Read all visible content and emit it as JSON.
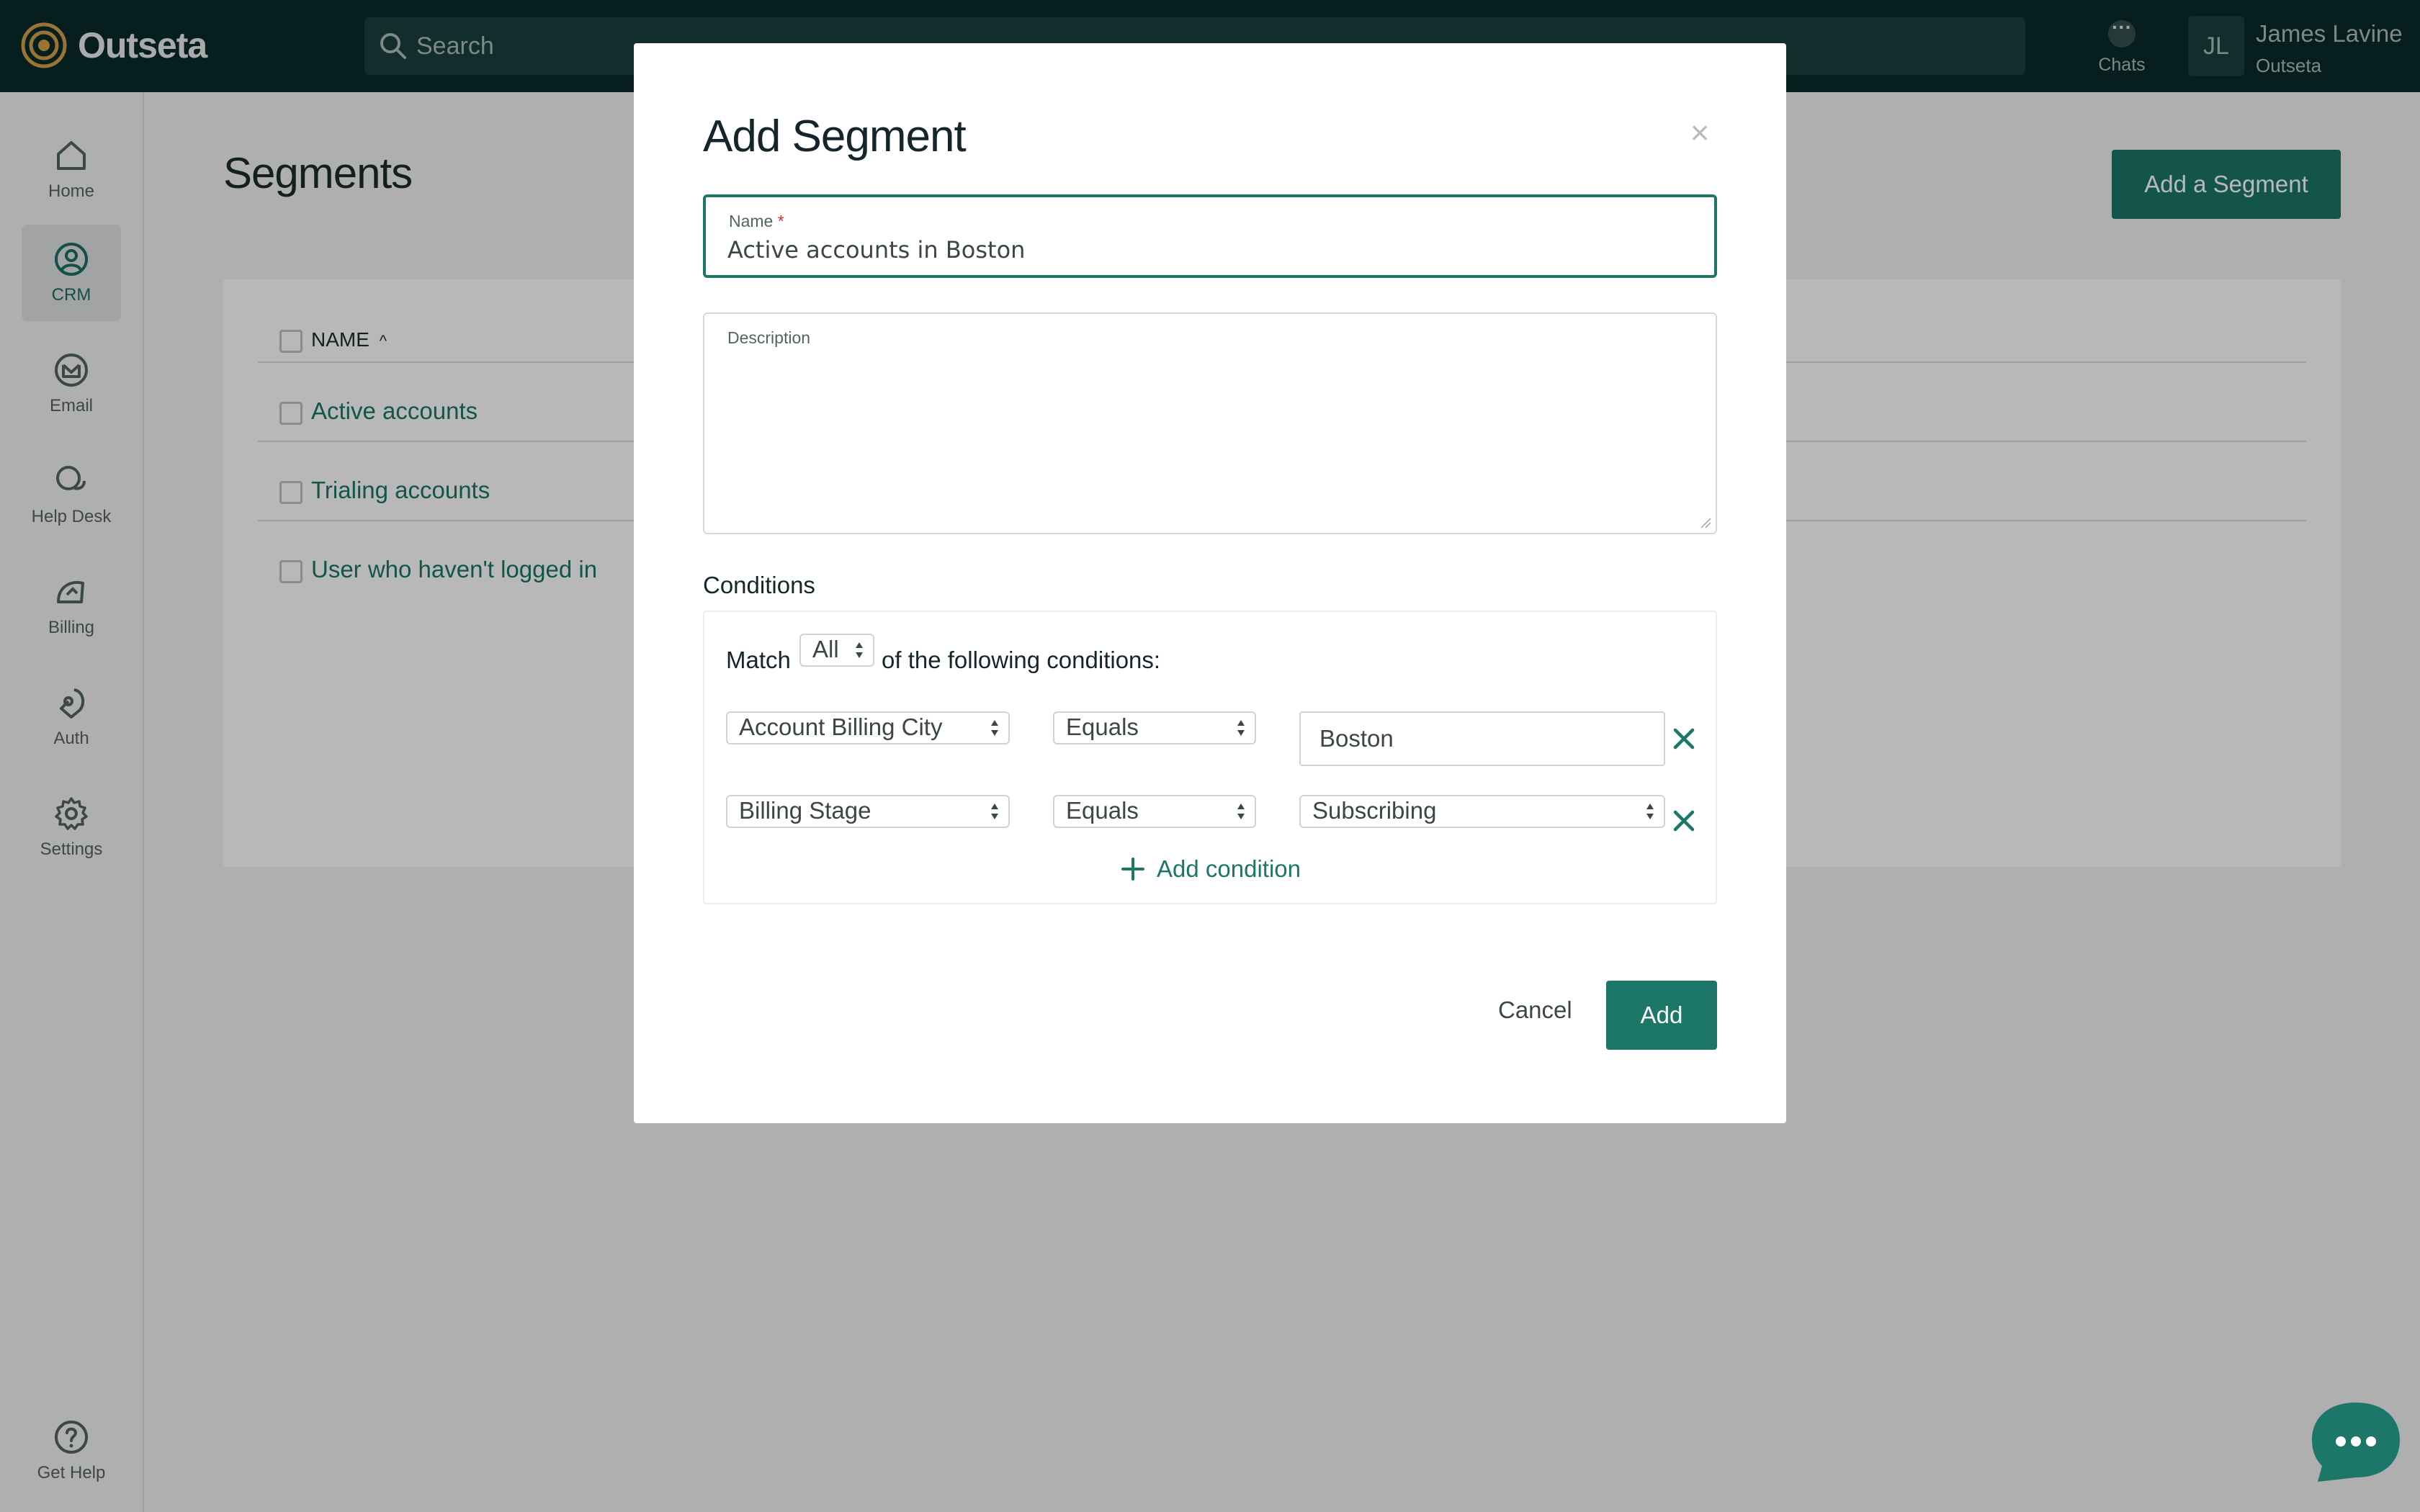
{
  "brand": {
    "name": "Outseta",
    "accent": "#1c7769",
    "topbar_bg": "#0a2a2b",
    "logo_color": "#d4a24a"
  },
  "topbar": {
    "search_placeholder": "Search",
    "chats_label": "Chats",
    "user_initials": "JL",
    "user_name": "James Lavine",
    "user_org": "Outseta"
  },
  "sidebar": {
    "items": [
      {
        "label": "Home",
        "icon": "home-icon",
        "active": false
      },
      {
        "label": "CRM",
        "icon": "crm-person-icon",
        "active": true
      },
      {
        "label": "Email",
        "icon": "email-icon",
        "active": false
      },
      {
        "label": "Help Desk",
        "icon": "help-desk-chat-icon",
        "active": false
      },
      {
        "label": "Billing",
        "icon": "billing-icon",
        "active": false
      },
      {
        "label": "Auth",
        "icon": "auth-icon",
        "active": false
      },
      {
        "label": "Settings",
        "icon": "gear-icon",
        "active": false
      }
    ],
    "help_label": "Get Help"
  },
  "page": {
    "title": "Segments",
    "add_button": "Add a Segment",
    "table": {
      "column_name": "NAME",
      "sort_indicator": "^",
      "rows": [
        "Active accounts",
        "Trialing accounts",
        "User who haven't logged in"
      ]
    }
  },
  "modal": {
    "title": "Add Segment",
    "close_glyph": "×",
    "name_label": "Name",
    "required_mark": "*",
    "name_value": "Active accounts in Boston",
    "description_label": "Description",
    "description_value": "",
    "conditions_heading": "Conditions",
    "match_label": "Match",
    "match_value": "All",
    "match_suffix": "of the following conditions:",
    "conditions": [
      {
        "field": "Account Billing City",
        "operator": "Equals",
        "value": "Boston",
        "value_kind": "text"
      },
      {
        "field": "Billing Stage",
        "operator": "Equals",
        "value": "Subscribing",
        "value_kind": "select"
      }
    ],
    "add_condition_label": "Add condition",
    "cancel_label": "Cancel",
    "submit_label": "Add"
  }
}
